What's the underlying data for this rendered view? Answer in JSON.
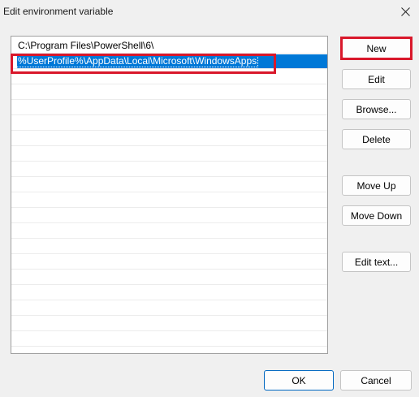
{
  "window": {
    "title": "Edit environment variable",
    "close_icon": "close-icon"
  },
  "list": {
    "items": [
      {
        "label": "C:\\Program Files\\PowerShell\\6\\",
        "selected": false
      },
      {
        "label": "%UserProfile%\\AppData\\Local\\Microsoft\\WindowsApps",
        "selected": true
      }
    ],
    "empty_row_count": 18
  },
  "buttons": {
    "new_label": "New",
    "edit_label": "Edit",
    "browse_label": "Browse...",
    "delete_label": "Delete",
    "move_up_label": "Move Up",
    "move_down_label": "Move Down",
    "edit_text_label": "Edit text...",
    "ok_label": "OK",
    "cancel_label": "Cancel"
  },
  "colors": {
    "selection": "#0078d7",
    "highlight_border": "#d9182b",
    "ok_border": "#0067c0"
  }
}
